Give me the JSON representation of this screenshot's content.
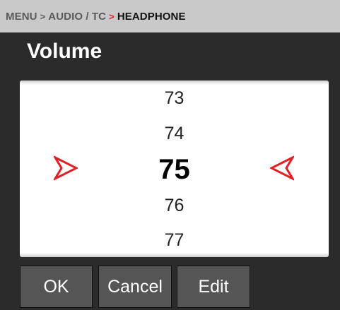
{
  "breadcrumb": {
    "item1": "MENU",
    "sep1": ">",
    "item2": "AUDIO / TC",
    "sep2": ">",
    "current": "HEADPHONE"
  },
  "title": "Volume",
  "picker": {
    "values": [
      "73",
      "74",
      "75",
      "76",
      "77"
    ],
    "selected": "75",
    "left_arrow_icon": "red-arrow-right-icon",
    "right_arrow_icon": "red-arrow-left-icon",
    "accent_color": "#e01f26"
  },
  "buttons": {
    "ok": "OK",
    "cancel": "Cancel",
    "edit": "Edit"
  }
}
